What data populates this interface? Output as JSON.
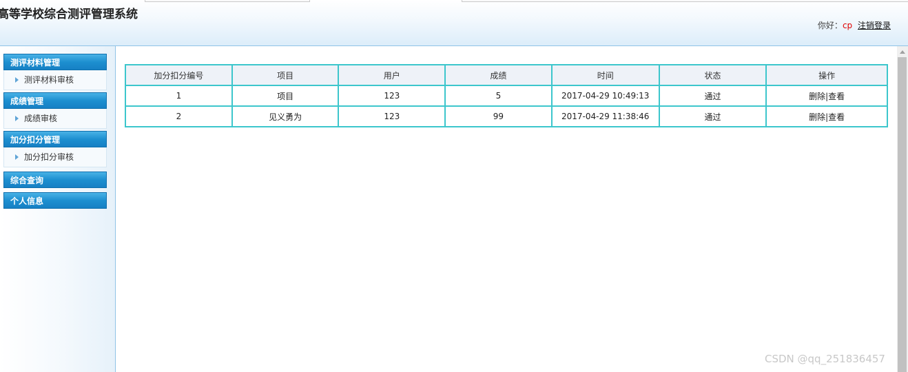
{
  "app": {
    "title": "高等学校综合测评管理系统"
  },
  "user": {
    "greeting": "你好：",
    "name": "cp",
    "logout": "注销登录"
  },
  "sidebar": {
    "groups": [
      {
        "title": "测评材料管理",
        "items": [
          "测评材料审核"
        ]
      },
      {
        "title": "成绩管理",
        "items": [
          "成绩审核"
        ]
      },
      {
        "title": "加分扣分管理",
        "items": [
          "加分扣分审核"
        ]
      },
      {
        "title": "综合查询",
        "items": []
      },
      {
        "title": "个人信息",
        "items": []
      }
    ]
  },
  "table": {
    "columns": [
      "加分扣分编号",
      "项目",
      "用户",
      "成绩",
      "时间",
      "状态",
      "操作"
    ],
    "rows": [
      {
        "id": "1",
        "project": "项目",
        "user": "123",
        "score": "5",
        "time": "2017-04-29 10:49:13",
        "status": "通过",
        "delete": "删除",
        "sep": "|",
        "view": "查看"
      },
      {
        "id": "2",
        "project": "见义勇为",
        "user": "123",
        "score": "99",
        "time": "2017-04-29 11:38:46",
        "status": "通过",
        "delete": "删除",
        "sep": "|",
        "view": "查看"
      }
    ]
  },
  "watermark": "CSDN @qq_251836457",
  "colors": {
    "accent": "#1d8fd0",
    "table_border": "#3cc6cc",
    "username": "#e00000"
  }
}
